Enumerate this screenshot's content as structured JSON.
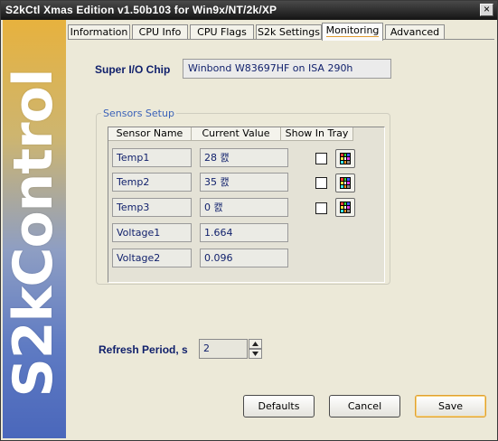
{
  "window": {
    "title": "S2kCtl Xmas Edition v1.50b103 for Win9x/NT/2k/XP",
    "close_glyph": "×"
  },
  "banner": {
    "logo_text": "S2kControl"
  },
  "tabs": [
    {
      "label": "Information"
    },
    {
      "label": "CPU Info"
    },
    {
      "label": "CPU Flags"
    },
    {
      "label": "S2k Settings"
    },
    {
      "label": "Monitoring",
      "active": true
    },
    {
      "label": "Advanced"
    }
  ],
  "superio": {
    "label": "Super I/O Chip",
    "value": "Winbond W83697HF on ISA 290h"
  },
  "sensors": {
    "group_title": "Sensors Setup",
    "columns": [
      "Sensor Name",
      "Current Value",
      "Show In Tray"
    ],
    "rows": [
      {
        "name": "Temp1",
        "value": "28 캜",
        "show_in_tray": false,
        "has_color_button": true
      },
      {
        "name": "Temp2",
        "value": "35 캜",
        "show_in_tray": false,
        "has_color_button": true
      },
      {
        "name": "Temp3",
        "value": "0 캜",
        "show_in_tray": false,
        "has_color_button": true
      },
      {
        "name": "Voltage1",
        "value": "1.664",
        "has_color_button": false
      },
      {
        "name": "Voltage2",
        "value": "0.096",
        "has_color_button": false
      }
    ]
  },
  "refresh": {
    "label": "Refresh Period, s",
    "value": "2"
  },
  "buttons": {
    "defaults": "Defaults",
    "cancel": "Cancel",
    "save": "Save"
  },
  "colors": {
    "label_navy": "#0f1f6b",
    "group_title_blue": "#3b62b8",
    "accent_orange": "#e29d35"
  }
}
